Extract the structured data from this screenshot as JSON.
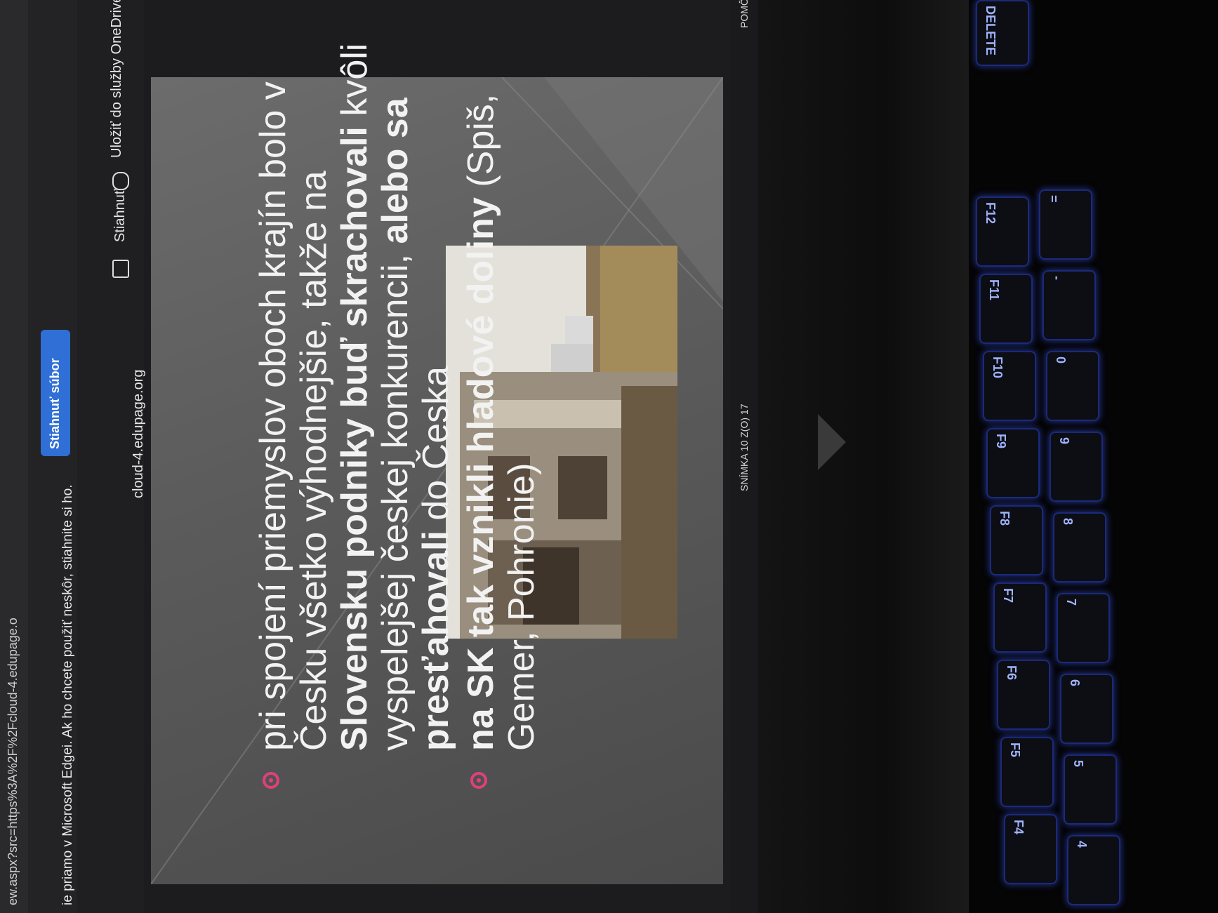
{
  "browser": {
    "address": "ew.aspx?src=https%3A%2F%2Fcloud-4.edupage.o",
    "notice": "ie priamo v Microsoft Edgei. Ak ho chcete použiť neskôr, stiahnite si ho.",
    "download_file": "Stiahnuť súbor"
  },
  "toolbar": {
    "domain": "cloud-4.edupage.org",
    "download": "Stiahnuť",
    "save_onedrive": "Uložiť do služby OneDrive"
  },
  "slide": {
    "bullet1": {
      "t1": "pri spojení priemyslov oboch krajín bolo v Česku všetko výhodnejšie, takže na ",
      "b1": "Slovensku podniky buď skrachovali",
      "t2": " kvôli vyspelejšej českej konkurencii, ",
      "b2": "alebo sa presťahovali",
      "t3": " do Česka"
    },
    "bullet2": {
      "b1": "na SK tak vznikli hladové doliny",
      "t1": " (Spiš, Gemer, Pohronie)"
    },
    "accent_color": "#e0407a"
  },
  "status": {
    "slide_counter": "SNÍMKA 10 Z(O) 17",
    "help": "POMÔC"
  },
  "keyboard": {
    "keys": [
      "F4",
      "F5",
      "F6",
      "F7",
      "F8",
      "F9",
      "F10",
      "F11",
      "F12",
      "DELETE",
      "4",
      "5",
      "6",
      "7",
      "8",
      "9",
      "0",
      "-",
      "="
    ]
  }
}
